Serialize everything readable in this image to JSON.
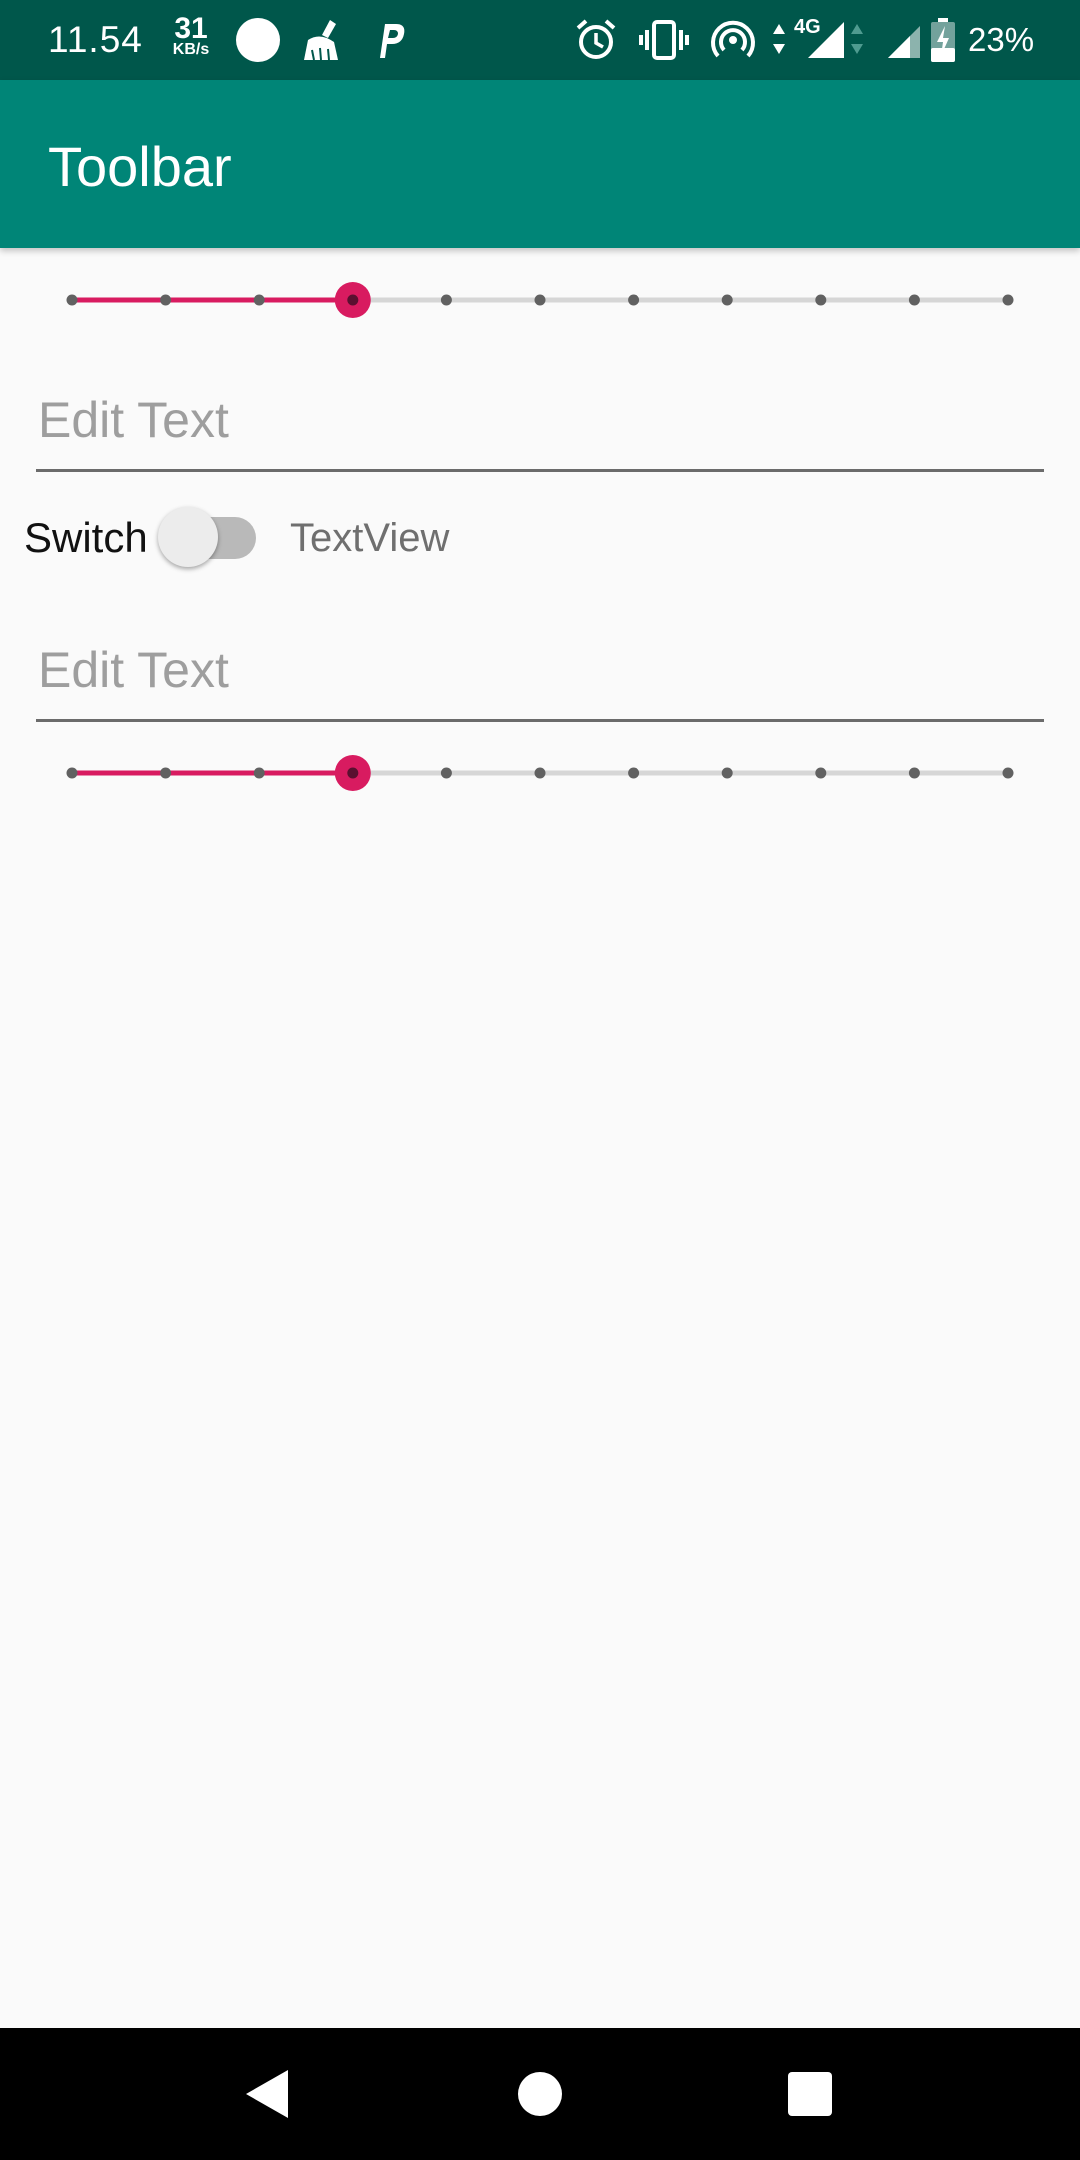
{
  "status_bar": {
    "time": "11.54",
    "net_speed_value": "31",
    "net_speed_unit": "KB/s",
    "battery_percent": "23%",
    "network_type": "4G",
    "icons": [
      "circle-notification-icon",
      "cleaner-icon",
      "parking-icon",
      "alarm-icon",
      "vibrate-icon",
      "hotspot-icon",
      "data-arrows-icon",
      "signal-icon",
      "signal-icon",
      "battery-charging-icon"
    ]
  },
  "toolbar": {
    "title": "Toolbar"
  },
  "seekbar_top": {
    "max": 10,
    "progress": 3
  },
  "edit_text_1": {
    "placeholder": "Edit Text",
    "value": ""
  },
  "switch": {
    "label": "Switch",
    "checked": false
  },
  "textview": {
    "text": "TextView"
  },
  "edit_text_2": {
    "placeholder": "Edit Text",
    "value": ""
  },
  "seekbar_bottom": {
    "max": 10,
    "progress": 3
  },
  "nav_bar": {
    "icons": [
      "back-icon",
      "home-icon",
      "recents-icon"
    ]
  },
  "colors": {
    "status_bar": "#00574b",
    "primary": "#008577",
    "accent": "#d81b60",
    "background": "#fafafa",
    "track": "#d6d6d6",
    "tick": "#616161"
  }
}
